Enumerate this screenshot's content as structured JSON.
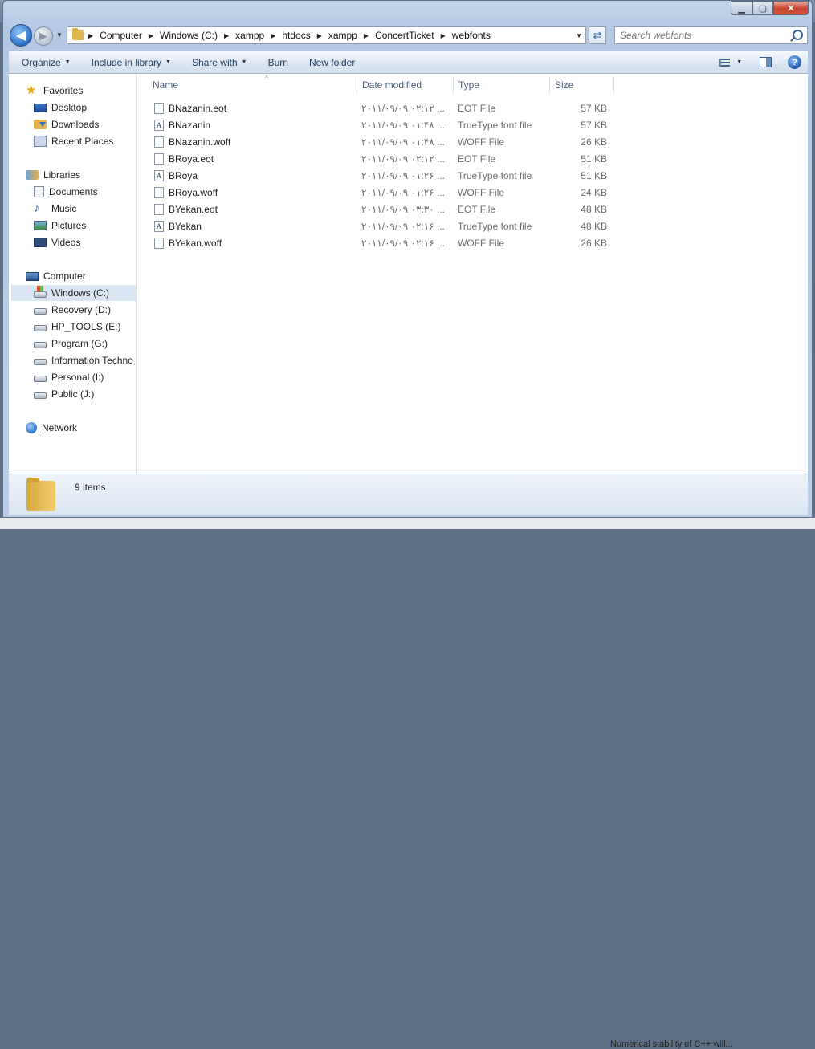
{
  "window": {
    "min_glyph": "▁",
    "max_glyph": "▢",
    "close_glyph": "✕"
  },
  "nav": {
    "back_glyph": "◀",
    "forward_glyph": "▶",
    "dropdown_glyph": "▼",
    "refresh_glyph": "⇄"
  },
  "address": {
    "separator_glyph": "▶",
    "crumbs": [
      "Computer",
      "Windows (C:)",
      "xampp",
      "htdocs",
      "xampp",
      "ConcertTicket",
      "webfonts"
    ]
  },
  "search": {
    "placeholder": "Search webfonts"
  },
  "toolbar": {
    "organize": "Organize",
    "include_in_library": "Include in library",
    "share_with": "Share with",
    "burn": "Burn",
    "new_folder": "New folder",
    "dropdown_glyph": "▼",
    "help_glyph": "?"
  },
  "sidebar": {
    "favorites": {
      "label": "Favorites",
      "icon": "star-icon",
      "items": [
        {
          "label": "Desktop",
          "icon": "desktop-icon"
        },
        {
          "label": "Downloads",
          "icon": "downloads-icon"
        },
        {
          "label": "Recent Places",
          "icon": "recent-places-icon"
        }
      ]
    },
    "libraries": {
      "label": "Libraries",
      "icon": "libraries-icon",
      "items": [
        {
          "label": "Documents",
          "icon": "documents-icon"
        },
        {
          "label": "Music",
          "icon": "music-icon"
        },
        {
          "label": "Pictures",
          "icon": "pictures-icon"
        },
        {
          "label": "Videos",
          "icon": "videos-icon"
        }
      ]
    },
    "computer": {
      "label": "Computer",
      "icon": "computer-icon",
      "items": [
        {
          "label": "Windows (C:)",
          "icon": "windows-drive-icon",
          "selected": true
        },
        {
          "label": "Recovery (D:)",
          "icon": "drive-icon"
        },
        {
          "label": "HP_TOOLS (E:)",
          "icon": "drive-icon"
        },
        {
          "label": "Program (G:)",
          "icon": "drive-icon"
        },
        {
          "label": "Information Techno",
          "icon": "drive-icon"
        },
        {
          "label": "Personal (I:)",
          "icon": "drive-icon"
        },
        {
          "label": "Public (J:)",
          "icon": "drive-icon"
        }
      ]
    },
    "network": {
      "label": "Network",
      "icon": "network-icon"
    }
  },
  "columns": {
    "name": "Name",
    "date_modified": "Date modified",
    "type": "Type",
    "size": "Size",
    "sort_glyph": "^"
  },
  "files": [
    {
      "name": "BNazanin.eot",
      "date": "۲۰۱۱/۰۹/۰۹ ۰۲:۱۲ ...",
      "type": "EOT File",
      "size": "57 KB",
      "icon": "file-icon"
    },
    {
      "name": "BNazanin",
      "date": "۲۰۱۱/۰۹/۰۹ ۰۱:۴۸ ...",
      "type": "TrueType font file",
      "size": "57 KB",
      "icon": "font-file-icon",
      "icon_glyph": "A"
    },
    {
      "name": "BNazanin.woff",
      "date": "۲۰۱۱/۰۹/۰۹ ۰۱:۴۸ ...",
      "type": "WOFF File",
      "size": "26 KB",
      "icon": "file-icon"
    },
    {
      "name": "BRoya.eot",
      "date": "۲۰۱۱/۰۹/۰۹ ۰۲:۱۲ ...",
      "type": "EOT File",
      "size": "51 KB",
      "icon": "file-icon"
    },
    {
      "name": "BRoya",
      "date": "۲۰۱۱/۰۹/۰۹ ۰۱:۲۶ ...",
      "type": "TrueType font file",
      "size": "51 KB",
      "icon": "font-file-icon",
      "icon_glyph": "A"
    },
    {
      "name": "BRoya.woff",
      "date": "۲۰۱۱/۰۹/۰۹ ۰۱:۲۶ ...",
      "type": "WOFF File",
      "size": "24 KB",
      "icon": "file-icon"
    },
    {
      "name": "BYekan.eot",
      "date": "۲۰۱۱/۰۹/۰۹ ۰۳:۳۰ ...",
      "type": "EOT File",
      "size": "48 KB",
      "icon": "file-icon"
    },
    {
      "name": "BYekan",
      "date": "۲۰۱۱/۰۹/۰۹ ۰۲:۱۶ ...",
      "type": "TrueType font file",
      "size": "48 KB",
      "icon": "font-file-icon",
      "icon_glyph": "A"
    },
    {
      "name": "BYekan.woff",
      "date": "۲۰۱۱/۰۹/۰۹ ۰۲:۱۶ ...",
      "type": "WOFF File",
      "size": "26 KB",
      "icon": "file-icon"
    }
  ],
  "status": {
    "item_count": "9 items"
  },
  "background": {
    "bottom_text": "Numerical stability of C++ will..."
  }
}
